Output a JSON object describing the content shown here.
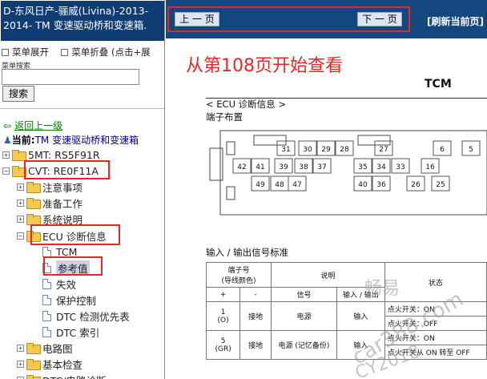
{
  "left_pane": {
    "title": "D-东风日产-骊威(Livina)-2013-2014- TM 变速驱动桥和变速箱.",
    "menu_expand": "菜单展开",
    "menu_collapse": "菜单折叠 (点击+展",
    "search_label": "菜单搜索",
    "search_placeholder": "",
    "search_button": "搜索",
    "back_link": "返回上一级",
    "current_prefix": "当前:",
    "current_value": "TM 变速驱动桥和变速箱",
    "tree": [
      {
        "label": "5MT: RS5F91R"
      },
      {
        "label": "CVT: RE0F11A"
      },
      {
        "label": "注意事项"
      },
      {
        "label": "准备工作"
      },
      {
        "label": "系统说明"
      },
      {
        "label": "ECU 诊断信息"
      },
      {
        "label": "TCM"
      },
      {
        "label": "参考值"
      },
      {
        "label": "失效"
      },
      {
        "label": "保护控制"
      },
      {
        "label": "DTC 检测优先表"
      },
      {
        "label": "DTC 索引"
      },
      {
        "label": "电路图"
      },
      {
        "label": "基本检查"
      },
      {
        "label": "DTC/电路诊断"
      }
    ]
  },
  "right_pane": {
    "prev_button": "上 一 页",
    "next_button": "下 一 页",
    "refresh": "[刷新当前页]",
    "start_note": "从第108页开始查看",
    "doc": {
      "title": "TCM",
      "ecu_heading": "< ECU 诊断信息 >",
      "terminal_layout": "端子布置",
      "connector_pins_row1": [
        "31",
        "30",
        "29",
        "28",
        "27",
        "6",
        "5"
      ],
      "connector_pins_row2": [
        "42",
        "41",
        "39",
        "38",
        "37",
        "35",
        "34",
        "33",
        "16"
      ],
      "connector_pins_row3": [
        "49",
        "48",
        "47",
        "40",
        "36",
        "26",
        "25"
      ],
      "io_label": "输入 / 输出信号标准",
      "table": {
        "h_terminal": "端子号\n(导线颜色)",
        "h_desc": "说明",
        "h_status": "状态",
        "h_plus": "+",
        "h_minus": "-",
        "h_signal": "信号",
        "h_io": "输入 / 输出",
        "rows": [
          {
            "terminal": "1\n(O)",
            "ground": "接地",
            "signal": "电源",
            "io": "输入",
            "cond": "点火开关：ON",
            "cond2": "点火开关：OFF"
          },
          {
            "terminal": "5\n(GR)",
            "ground": "接地",
            "signal": "电源 (记忆备份)",
            "io": "输入",
            "cond": "点火开关：ON",
            "cond2": "点火开关从 ON 转至 OFF"
          }
        ]
      }
    }
  },
  "watermark": {
    "line1": "畅易",
    "line2": "car388.com",
    "line3": "CY2018"
  },
  "colors": {
    "title_bg": "#0f3d73",
    "nav_bg": "#15477f",
    "highlight": "#e8262a",
    "link": "#008000"
  }
}
